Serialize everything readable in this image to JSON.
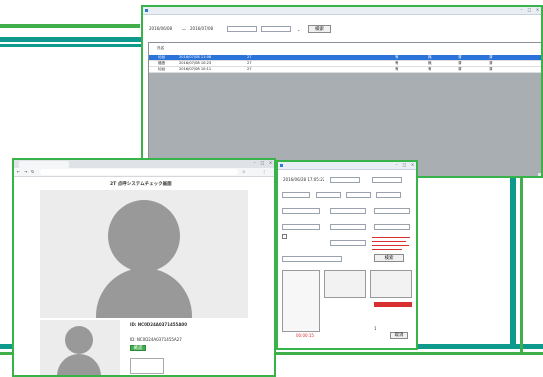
{
  "win1": {
    "date_from": "2016/06/08",
    "date_to": "2016/07/08",
    "date_sep": "〜",
    "search_label": "検索",
    "cols": [
      "氏名",
      "",
      "",
      "",
      "",
      "",
      "",
      "",
      "",
      "",
      "",
      "",
      "",
      ""
    ],
    "rows": [
      [
        "仙台",
        "2016/07/08 11:08",
        "",
        "27",
        "",
        "",
        "",
        "",
        "",
        "有",
        "無",
        "済",
        "済"
      ],
      [
        "福島",
        "2016/07/08 10:23",
        "",
        "27",
        "",
        "",
        "",
        "",
        "",
        "有",
        "無",
        "済",
        "済"
      ],
      [
        "仙台",
        "2016/07/08 10:11",
        "",
        "27",
        "",
        "",
        "",
        "",
        "",
        "有",
        "有",
        "済",
        "済"
      ]
    ]
  },
  "win2": {
    "page_title": "2T 点呼システムチェック画面",
    "id_line_1": "ID: NC0D24A0371455A00",
    "id_line_2": "ID: NC0D24A0371455A27",
    "btn_label": "確認"
  },
  "win3": {
    "date_value": "2016/06/28 17:05:22",
    "search_btn": "検索",
    "status_text": "00:00:15",
    "count_prefix": "1",
    "cancel_btn": "取消"
  },
  "colors": {
    "frame_green": "#37b34a",
    "band_teal": "#0d9a8c",
    "select_blue": "#2a73d9",
    "alert_red": "#d83030"
  }
}
